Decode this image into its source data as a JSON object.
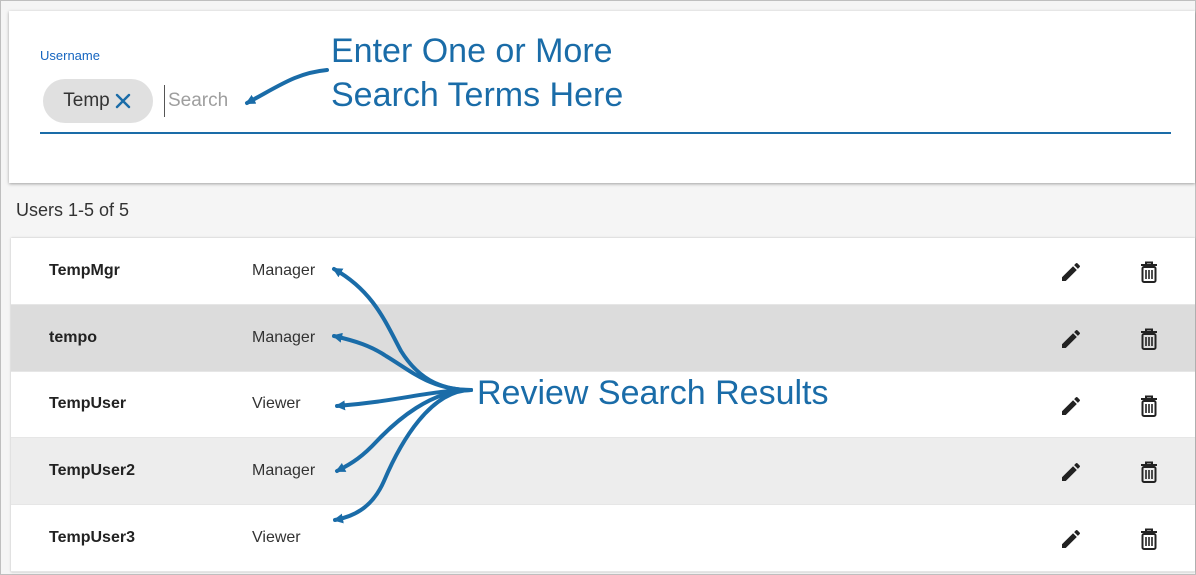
{
  "search": {
    "field_label": "Username",
    "chip_label": "Temp",
    "placeholder": "Search"
  },
  "results": {
    "count_text": "Users 1-5 of 5",
    "rows": [
      {
        "username": "TempMgr",
        "role": "Manager"
      },
      {
        "username": "tempo",
        "role": "Manager"
      },
      {
        "username": "TempUser",
        "role": "Viewer"
      },
      {
        "username": "TempUser2",
        "role": "Manager"
      },
      {
        "username": "TempUser3",
        "role": "Viewer"
      }
    ]
  },
  "annotations": {
    "search_line1": "Enter One or More",
    "search_line2": "Search Terms Here",
    "results": "Review Search Results"
  },
  "icons": {
    "chip_remove": "close-icon",
    "edit": "pencil-icon",
    "delete": "trash-icon"
  },
  "colors": {
    "accent": "#1a6ca8",
    "label_blue": "#1565c0",
    "chip_bg": "#e0e0e0",
    "row_highlight": "#dcdcdc"
  }
}
